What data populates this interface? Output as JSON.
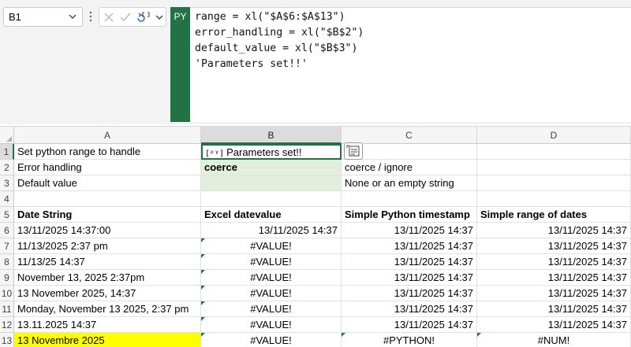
{
  "name_box": "B1",
  "formula": {
    "language_tag": "PY",
    "lines": [
      "range = xl(\"$A$6:$A$13\")",
      "error_handling = xl(\"$B$2\")",
      "default_value = xl(\"$B$3\")",
      "'Parameters set!!'"
    ]
  },
  "columns": [
    "A",
    "B",
    "C",
    "D"
  ],
  "rows": [
    "1",
    "2",
    "3",
    "4",
    "5",
    "6",
    "7",
    "8",
    "9",
    "10",
    "11",
    "12",
    "13"
  ],
  "cells": {
    "r1": {
      "a": "Set python range to handle",
      "b_badge": "[ᵖʸ]",
      "b": "Parameters set!!",
      "c": "",
      "d": ""
    },
    "r2": {
      "a": "Error handling",
      "b": "coerce",
      "c": "coerce / ignore",
      "d": ""
    },
    "r3": {
      "a": "Default value",
      "b": "",
      "c": "None or an empty string",
      "d": ""
    },
    "r4": {
      "a": "",
      "b": "",
      "c": "",
      "d": ""
    },
    "r5": {
      "a": "Date String",
      "b": "Excel datevalue",
      "c": "Simple Python timestamp",
      "d": "Simple range of dates"
    },
    "r6": {
      "a": "13/11/2025  14:37:00",
      "b": "13/11/2025 14:37",
      "c": "13/11/2025 14:37",
      "d": "13/11/2025 14:37"
    },
    "r7": {
      "a": "11/13/2025 2:37 pm",
      "b": "#VALUE!",
      "c": "13/11/2025 14:37",
      "d": "13/11/2025 14:37"
    },
    "r8": {
      "a": "11/13/25  14:37",
      "b": "#VALUE!",
      "c": "13/11/2025 14:37",
      "d": "13/11/2025 14:37"
    },
    "r9": {
      "a": "November 13, 2025 2:37pm",
      "b": "#VALUE!",
      "c": "13/11/2025 14:37",
      "d": "13/11/2025 14:37"
    },
    "r10": {
      "a": "13 November 2025, 14:37",
      "b": "#VALUE!",
      "c": "13/11/2025 14:37",
      "d": "13/11/2025 14:37"
    },
    "r11": {
      "a": "Monday, November 13 2025, 2:37 pm",
      "b": "#VALUE!",
      "c": "13/11/2025 14:37",
      "d": "13/11/2025 14:37"
    },
    "r12": {
      "a": "13.11.2025 14:37",
      "b": "#VALUE!",
      "c": "13/11/2025 14:37",
      "d": "13/11/2025 14:37"
    },
    "r13": {
      "a": "13 Novembre 2025",
      "b": "#VALUE!",
      "c": "#PYTHON!",
      "d": "#NUM!"
    }
  },
  "colors": {
    "accent": "#217346",
    "input_fill": "#e2efda",
    "highlight": "#ffff00",
    "error_marker": "#1e7b3c"
  },
  "icons": [
    "chevron-down-icon",
    "more-vertical-icon",
    "cancel-icon",
    "enter-icon",
    "python-insert-icon",
    "card-view-icon"
  ]
}
